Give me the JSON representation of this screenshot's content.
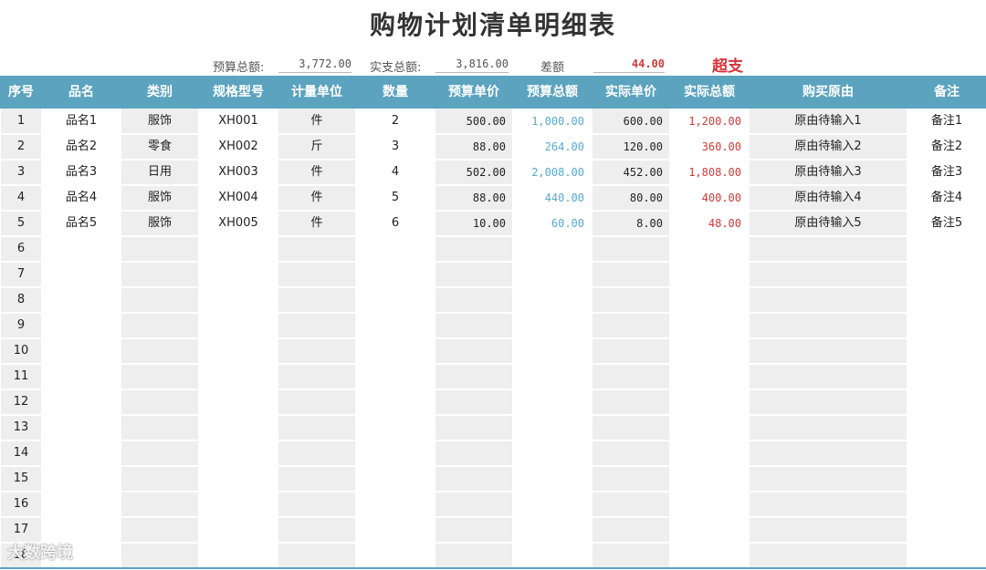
{
  "title": "购物计划清单明细表",
  "summary": {
    "budget_label": "预算总额:",
    "budget_value": "3,772.00",
    "actual_label": "实支总额:",
    "actual_value": "3,816.00",
    "diff_label": "差额",
    "diff_value": "44.00",
    "status": "超支"
  },
  "columns": [
    "序号",
    "品名",
    "类别",
    "规格型号",
    "计量单位",
    "数量",
    "预算单价",
    "预算总额",
    "实际单价",
    "实际总额",
    "购买原由",
    "备注"
  ],
  "rows": [
    [
      "1",
      "品名1",
      "服饰",
      "XH001",
      "件",
      "2",
      "500.00",
      "1,000.00",
      "600.00",
      "1,200.00",
      "原由待输入1",
      "备注1"
    ],
    [
      "2",
      "品名2",
      "零食",
      "XH002",
      "斤",
      "3",
      "88.00",
      "264.00",
      "120.00",
      "360.00",
      "原由待输入2",
      "备注2"
    ],
    [
      "3",
      "品名3",
      "日用",
      "XH003",
      "件",
      "4",
      "502.00",
      "2,008.00",
      "452.00",
      "1,808.00",
      "原由待输入3",
      "备注3"
    ],
    [
      "4",
      "品名4",
      "服饰",
      "XH004",
      "件",
      "5",
      "88.00",
      "440.00",
      "80.00",
      "400.00",
      "原由待输入4",
      "备注4"
    ],
    [
      "5",
      "品名5",
      "服饰",
      "XH005",
      "件",
      "6",
      "10.00",
      "60.00",
      "8.00",
      "48.00",
      "原由待输入5",
      "备注5"
    ],
    [
      "6",
      "",
      "",
      "",
      "",
      "",
      "",
      "",
      "",
      "",
      "",
      ""
    ],
    [
      "7",
      "",
      "",
      "",
      "",
      "",
      "",
      "",
      "",
      "",
      "",
      ""
    ],
    [
      "8",
      "",
      "",
      "",
      "",
      "",
      "",
      "",
      "",
      "",
      "",
      ""
    ],
    [
      "9",
      "",
      "",
      "",
      "",
      "",
      "",
      "",
      "",
      "",
      "",
      ""
    ],
    [
      "10",
      "",
      "",
      "",
      "",
      "",
      "",
      "",
      "",
      "",
      "",
      ""
    ],
    [
      "11",
      "",
      "",
      "",
      "",
      "",
      "",
      "",
      "",
      "",
      "",
      ""
    ],
    [
      "12",
      "",
      "",
      "",
      "",
      "",
      "",
      "",
      "",
      "",
      "",
      ""
    ],
    [
      "13",
      "",
      "",
      "",
      "",
      "",
      "",
      "",
      "",
      "",
      "",
      ""
    ],
    [
      "14",
      "",
      "",
      "",
      "",
      "",
      "",
      "",
      "",
      "",
      "",
      ""
    ],
    [
      "15",
      "",
      "",
      "",
      "",
      "",
      "",
      "",
      "",
      "",
      "",
      ""
    ],
    [
      "16",
      "",
      "",
      "",
      "",
      "",
      "",
      "",
      "",
      "",
      "",
      ""
    ],
    [
      "17",
      "",
      "",
      "",
      "",
      "",
      "",
      "",
      "",
      "",
      "",
      ""
    ],
    [
      "18",
      "",
      "",
      "",
      "",
      "",
      "",
      "",
      "",
      "",
      "",
      ""
    ]
  ],
  "watermark": "大数跨境",
  "colors": {
    "header": "#5ba3bf",
    "budget_total": "#5aa8cf",
    "actual_total": "#cf3a3a",
    "over": "#d6343c"
  }
}
